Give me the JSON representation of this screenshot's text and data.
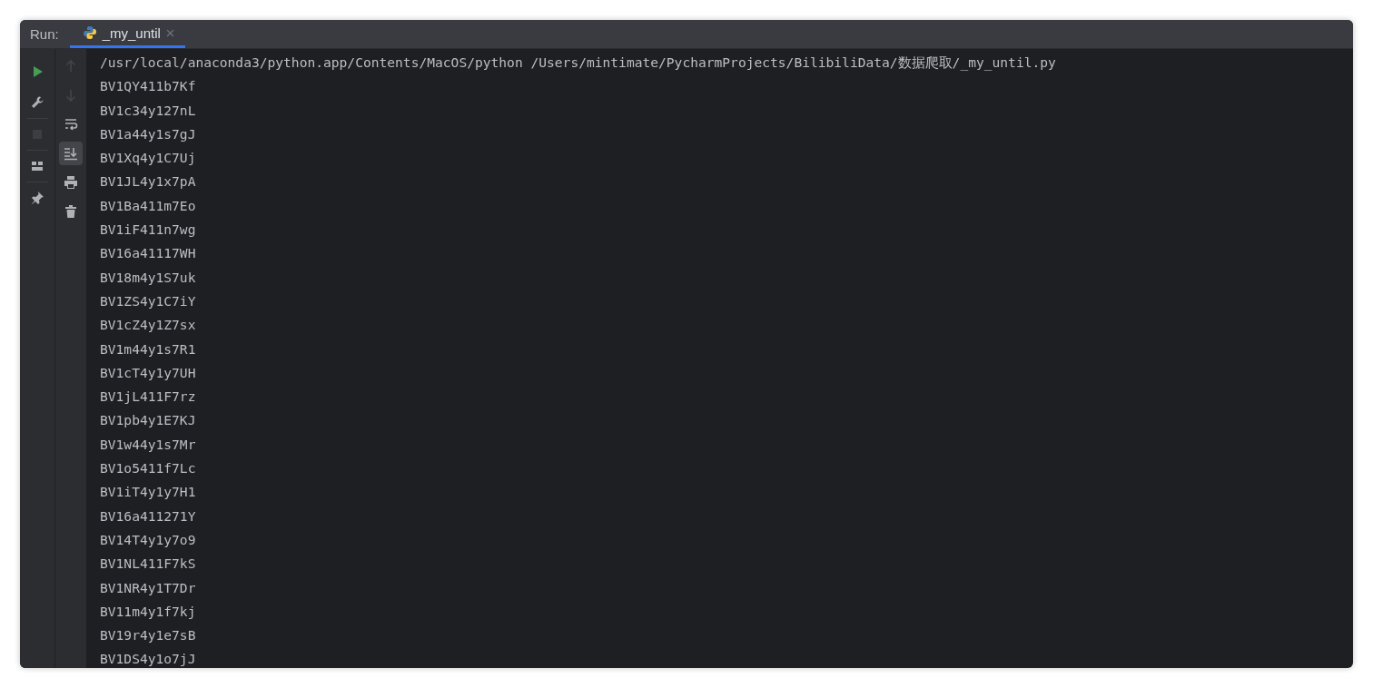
{
  "run_panel": {
    "label": "Run:",
    "tabs": [
      {
        "title": "_my_until",
        "selected": true
      }
    ]
  },
  "toolbar_primary": [
    {
      "kind": "run",
      "disabled": false
    },
    {
      "kind": "wrench",
      "disabled": false
    },
    {
      "kind": "stop",
      "disabled": true
    },
    {
      "kind": "layout",
      "disabled": false
    },
    {
      "kind": "pin",
      "disabled": false
    }
  ],
  "toolbar_secondary": [
    {
      "kind": "up",
      "disabled": true,
      "on": false
    },
    {
      "kind": "down",
      "disabled": true,
      "on": false
    },
    {
      "kind": "wrap",
      "disabled": false,
      "on": false
    },
    {
      "kind": "scroll-end",
      "disabled": false,
      "on": true
    },
    {
      "kind": "print",
      "disabled": false,
      "on": false
    },
    {
      "kind": "trash",
      "disabled": false,
      "on": false
    }
  ],
  "console": {
    "lines": [
      "/usr/local/anaconda3/python.app/Contents/MacOS/python /Users/mintimate/PycharmProjects/BilibiliData/数据爬取/_my_until.py",
      "BV1QY411b7Kf",
      "BV1c34y127nL",
      "BV1a44y1s7gJ",
      "BV1Xq4y1C7Uj",
      "BV1JL4y1x7pA",
      "BV1Ba411m7Eo",
      "BV1iF411n7wg",
      "BV16a41117WH",
      "BV18m4y1S7uk",
      "BV1ZS4y1C7iY",
      "BV1cZ4y1Z7sx",
      "BV1m44y1s7R1",
      "BV1cT4y1y7UH",
      "BV1jL411F7rz",
      "BV1pb4y1E7KJ",
      "BV1w44y1s7Mr",
      "BV1o5411f7Lc",
      "BV1iT4y1y7H1",
      "BV16a411271Y",
      "BV14T4y1y7o9",
      "BV1NL411F7kS",
      "BV1NR4y1T7Dr",
      "BV11m4y1f7kj",
      "BV19r4y1e7sB",
      "BV1DS4y1o7jJ"
    ]
  }
}
